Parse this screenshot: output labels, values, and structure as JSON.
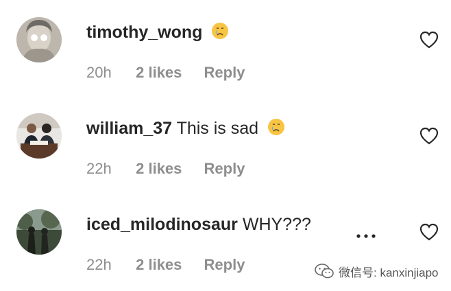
{
  "comments": [
    {
      "username": "timothy_wong",
      "message": "",
      "emoji": "crying-face",
      "time": "20h",
      "likes": "2 likes",
      "reply": "Reply"
    },
    {
      "username": "william_37",
      "message": "This is sad",
      "emoji": "crying-face",
      "time": "22h",
      "likes": "2 likes",
      "reply": "Reply"
    },
    {
      "username": "iced_milodinosaur",
      "message": "WHY???",
      "emoji": "",
      "time": "22h",
      "likes": "2 likes",
      "reply": "Reply"
    }
  ],
  "watermark": {
    "icon": "wechat-icon",
    "text": "微信号: kanxinjiapo"
  },
  "colors": {
    "text": "#262626",
    "meta": "#8e8e8e",
    "emoji_face": "#f7c443"
  }
}
